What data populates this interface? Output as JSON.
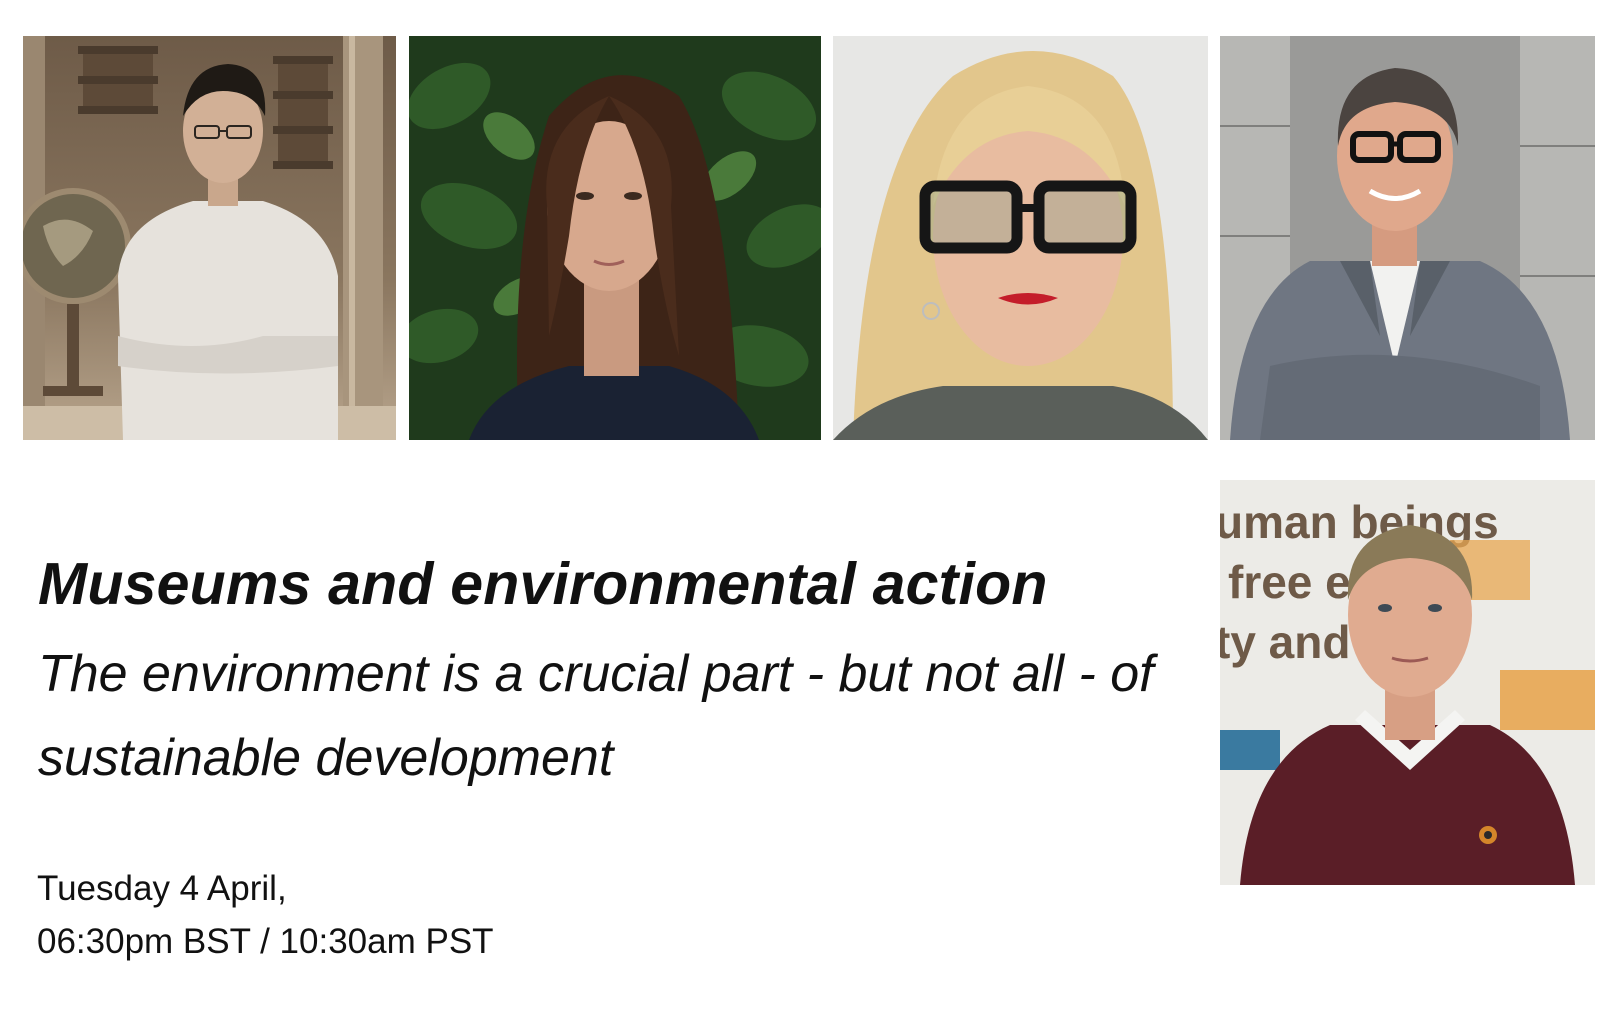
{
  "event": {
    "title": "Museums and environmental action",
    "subtitle": "The environment is a crucial part - but not all - of sustainable development",
    "date_line": "Tuesday 4 April,",
    "time_line": "06:30pm BST / 10:30am PST"
  },
  "speaker_photos": [
    {
      "id": "speaker-1",
      "setting": "library with globe",
      "tone": "sepia"
    },
    {
      "id": "speaker-2",
      "setting": "green foliage",
      "tone": "color"
    },
    {
      "id": "speaker-3",
      "setting": "light grey wall",
      "tone": "color"
    },
    {
      "id": "speaker-4",
      "setting": "stone wall",
      "tone": "color"
    },
    {
      "id": "speaker-5",
      "setting": "exhibition wall with text",
      "tone": "color"
    }
  ],
  "background_text": {
    "wall_line_1": "uman beings",
    "wall_line_2": "free     equal",
    "wall_line_3": "ty and    ts."
  }
}
